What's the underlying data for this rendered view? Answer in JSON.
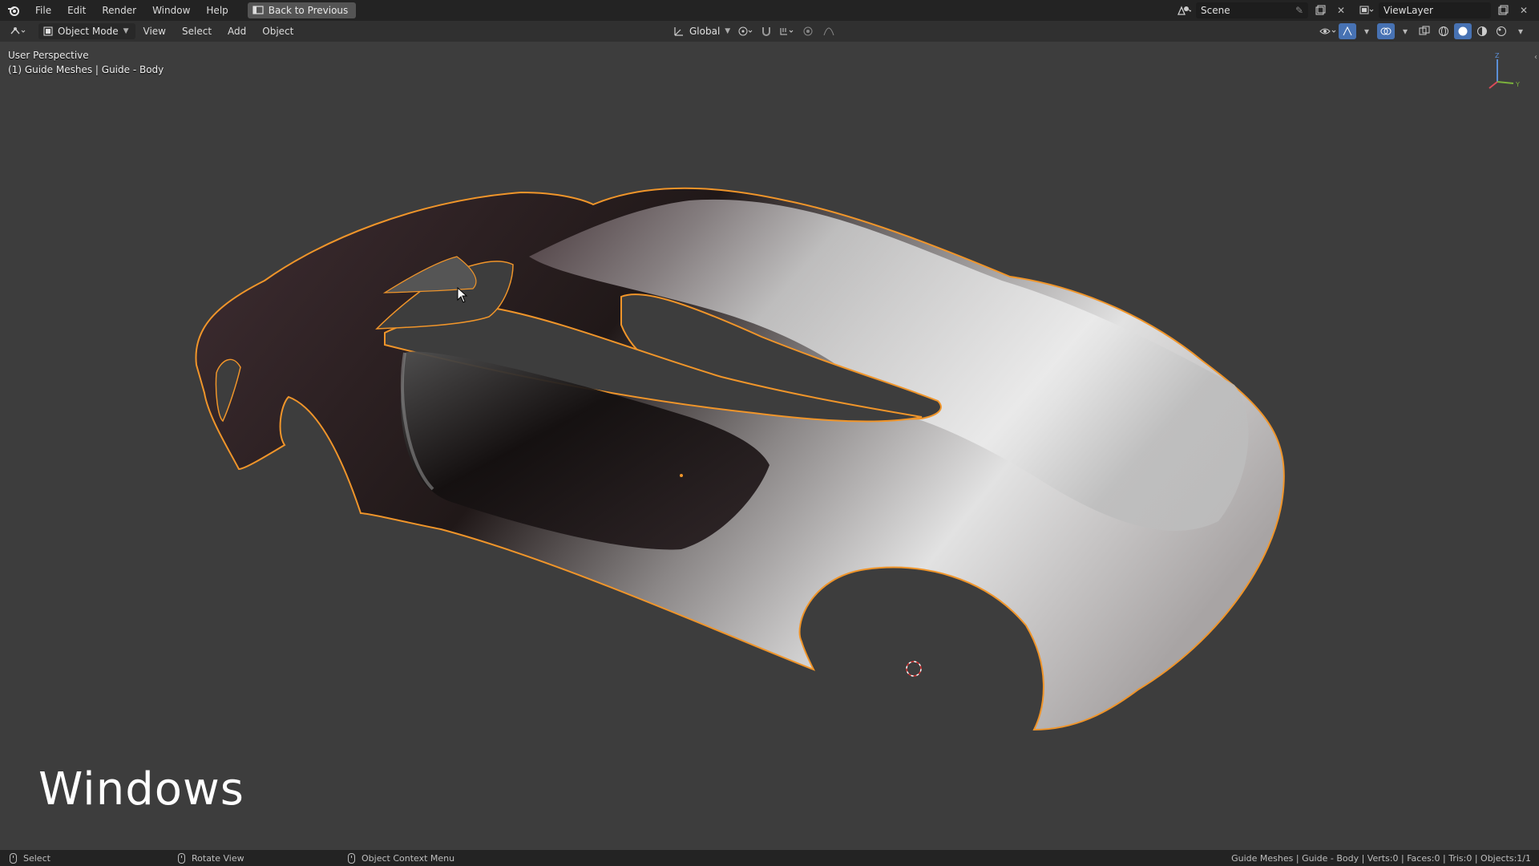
{
  "menu": {
    "items": [
      "File",
      "Edit",
      "Render",
      "Window",
      "Help"
    ],
    "back_button": "Back to Previous"
  },
  "scene": {
    "name": "Scene"
  },
  "view_layer": {
    "name": "ViewLayer"
  },
  "header": {
    "mode": "Object Mode",
    "menus": [
      "View",
      "Select",
      "Add",
      "Object"
    ],
    "transform_orientation": "Global"
  },
  "viewport": {
    "perspective_label": "User Perspective",
    "object_label": "(1) Guide Meshes | Guide - Body",
    "watermark": "Windows",
    "axes": {
      "x": "",
      "y": "Y",
      "z": "Z"
    }
  },
  "status": {
    "left": "Select",
    "middle": "Rotate View",
    "right": "Object Context Menu",
    "stats": "Guide Meshes | Guide - Body | Verts:0 | Faces:0 | Tris:0 | Objects:1/1"
  },
  "colors": {
    "selection_outline": "#f0952a",
    "viewport_bg": "#3d3d3d"
  }
}
